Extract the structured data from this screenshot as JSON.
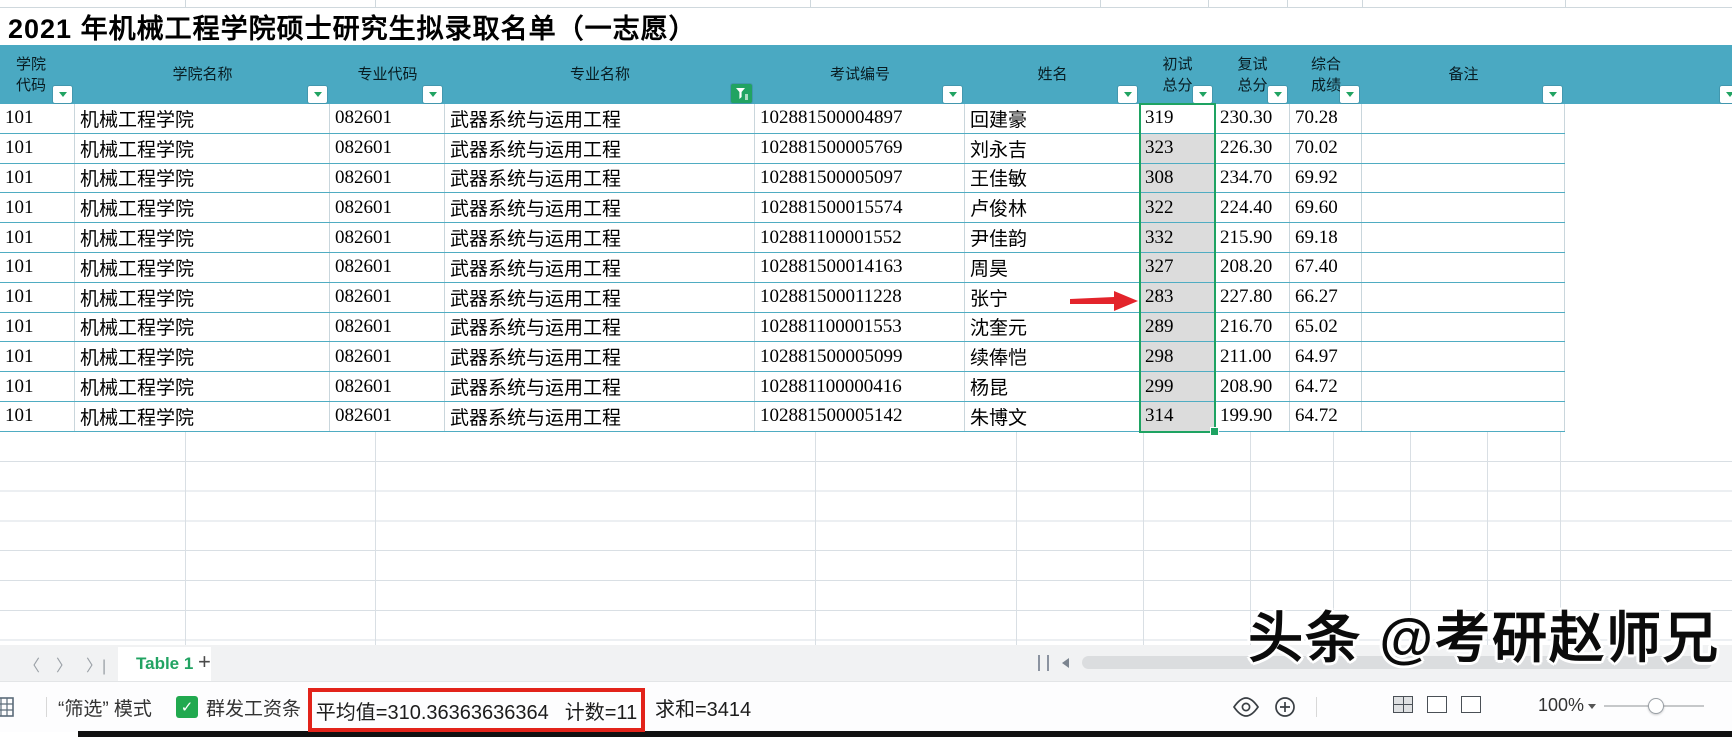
{
  "title": "2021 年机械工程学院硕士研究生拟录取名单（一志愿）",
  "table": {
    "columns": [
      {
        "label": "学院\n代码",
        "filter": "normal"
      },
      {
        "label": "学院名称",
        "filter": "normal"
      },
      {
        "label": "专业代码",
        "filter": "normal"
      },
      {
        "label": "专业名称",
        "filter": "active"
      },
      {
        "label": "考试编号",
        "filter": "normal"
      },
      {
        "label": "姓名",
        "filter": "normal"
      },
      {
        "label": "初试\n总分",
        "filter": "normal"
      },
      {
        "label": "复试\n总分",
        "filter": "normal"
      },
      {
        "label": "综合\n成绩",
        "filter": "normal"
      },
      {
        "label": "备注",
        "filter": "normal"
      }
    ],
    "rows": [
      [
        "101",
        "机械工程学院",
        "082601",
        "武器系统与运用工程",
        "102881500004897",
        "回建豪",
        "319",
        "230.30",
        "70.28",
        ""
      ],
      [
        "101",
        "机械工程学院",
        "082601",
        "武器系统与运用工程",
        "102881500005769",
        "刘永吉",
        "323",
        "226.30",
        "70.02",
        ""
      ],
      [
        "101",
        "机械工程学院",
        "082601",
        "武器系统与运用工程",
        "102881500005097",
        "王佳敏",
        "308",
        "234.70",
        "69.92",
        ""
      ],
      [
        "101",
        "机械工程学院",
        "082601",
        "武器系统与运用工程",
        "102881500015574",
        "卢俊林",
        "322",
        "224.40",
        "69.60",
        ""
      ],
      [
        "101",
        "机械工程学院",
        "082601",
        "武器系统与运用工程",
        "102881100001552",
        "尹佳韵",
        "332",
        "215.90",
        "69.18",
        ""
      ],
      [
        "101",
        "机械工程学院",
        "082601",
        "武器系统与运用工程",
        "102881500014163",
        "周昊",
        "327",
        "208.20",
        "67.40",
        ""
      ],
      [
        "101",
        "机械工程学院",
        "082601",
        "武器系统与运用工程",
        "102881500011228",
        "张宁",
        "283",
        "227.80",
        "66.27",
        ""
      ],
      [
        "101",
        "机械工程学院",
        "082601",
        "武器系统与运用工程",
        "102881100001553",
        "沈奎元",
        "289",
        "216.70",
        "65.02",
        ""
      ],
      [
        "101",
        "机械工程学院",
        "082601",
        "武器系统与运用工程",
        "102881500005099",
        "续俸恺",
        "298",
        "211.00",
        "64.97",
        ""
      ],
      [
        "101",
        "机械工程学院",
        "082601",
        "武器系统与运用工程",
        "102881100000416",
        "杨昆",
        "299",
        "208.90",
        "64.72",
        ""
      ],
      [
        "101",
        "机械工程学院",
        "082601",
        "武器系统与运用工程",
        "102881500005142",
        "朱博文",
        "314",
        "199.90",
        "64.72",
        ""
      ]
    ],
    "selection": {
      "column_index": 6,
      "column_label": "初试总分",
      "active_cell_value": "319"
    }
  },
  "sheet_bar": {
    "active_tab": "Table 1",
    "add_label": "+"
  },
  "status_bar": {
    "mode": "“筛选” 模式",
    "plugin": "群发工资条",
    "average": "平均值=310.36363636364",
    "count": "计数=11",
    "sum": "求和=3414",
    "zoom": "100%"
  },
  "watermark": "头条 @考研赵师兄",
  "colors": {
    "header_teal": "#4AA9C2",
    "selection_green": "#1EA362",
    "filter_green": "#21A362",
    "highlight_red": "#E2231A",
    "tab_green": "#21A362",
    "selected_cell_gray": "#DCDCDC"
  }
}
